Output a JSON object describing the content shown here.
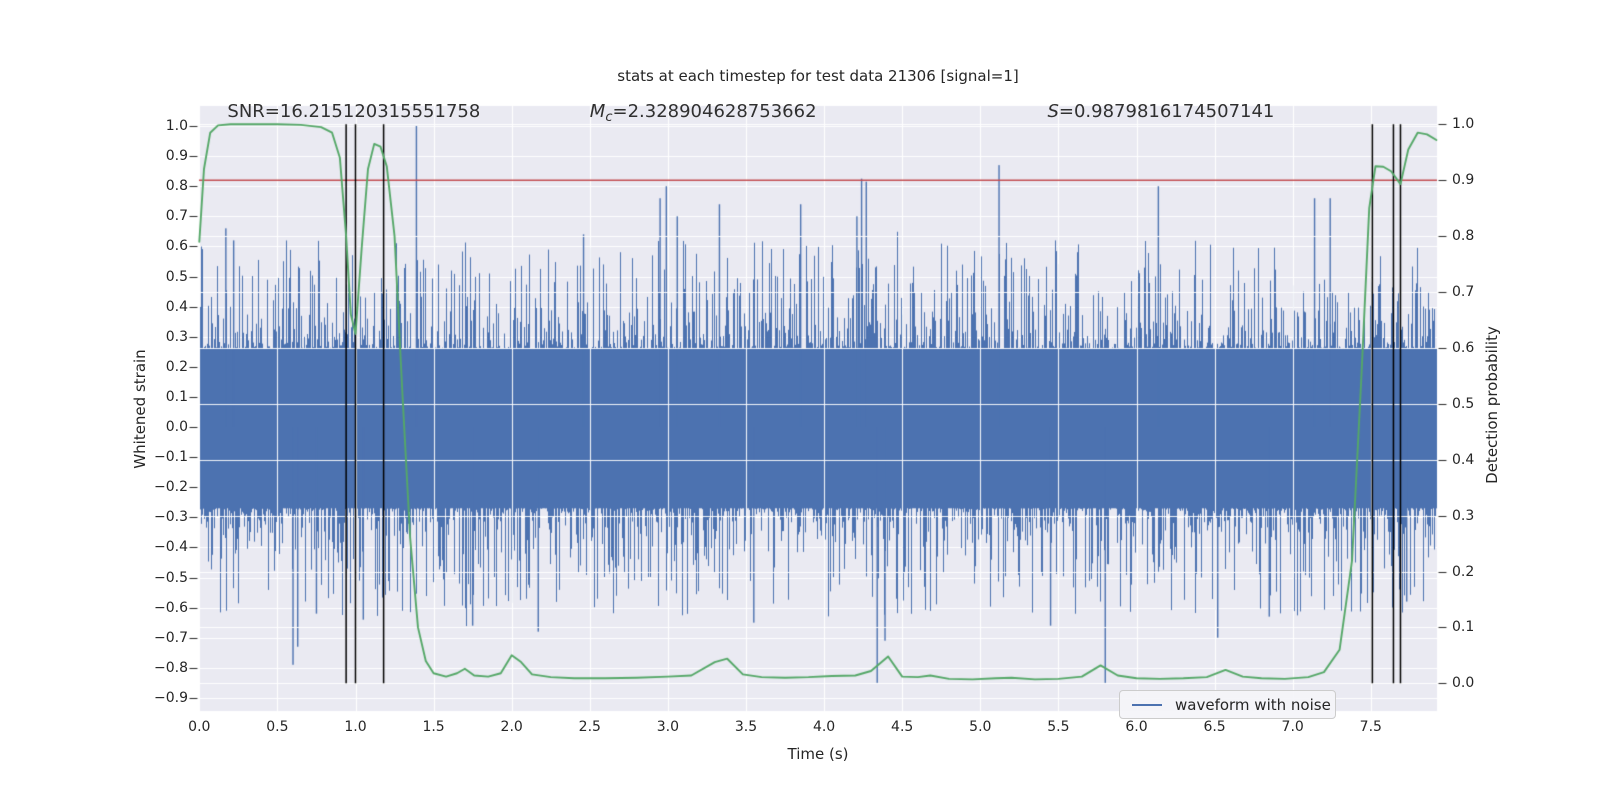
{
  "figure_title": "stats at each timestep for test data 21306 [signal=1]",
  "annotations": [
    {
      "name": "snr",
      "x": 0.18,
      "segments": [
        {
          "text": "SNR=16.215120315551758",
          "style": "plain"
        }
      ]
    },
    {
      "name": "chirp-mass",
      "x": 2.5,
      "segments": [
        {
          "text": "M",
          "style": "italic"
        },
        {
          "text": "c",
          "style": "sub"
        },
        {
          "text": "=2.328904628753662",
          "style": "plain"
        }
      ]
    },
    {
      "name": "s-stat",
      "x": 5.43,
      "segments": [
        {
          "text": "S",
          "style": "italic"
        },
        {
          "text": "=0.9879816174507141",
          "style": "plain"
        }
      ]
    }
  ],
  "legend": {
    "label": "waveform with noise"
  },
  "chart_data": {
    "type": "line",
    "title": "stats at each timestep for test data 21306 [signal=1]",
    "x_axis": {
      "label": "Time (s)",
      "range": [
        0,
        7.92
      ],
      "ticks": [
        0.0,
        0.5,
        1.0,
        1.5,
        2.0,
        2.5,
        3.0,
        3.5,
        4.0,
        4.5,
        5.0,
        5.5,
        6.0,
        6.5,
        7.0,
        7.5
      ]
    },
    "y_left": {
      "label": "Whitened strain",
      "range": [
        -0.943,
        1.067
      ],
      "ticks": [
        1.0,
        0.9,
        0.8,
        0.7,
        0.6,
        0.5,
        0.4,
        0.3,
        0.2,
        0.1,
        0.0,
        -0.1,
        -0.2,
        -0.3,
        -0.4,
        -0.5,
        -0.6,
        -0.7,
        -0.8,
        -0.9
      ]
    },
    "y_right": {
      "label": "Detection probability",
      "range": [
        -0.05,
        1.033
      ],
      "ticks": [
        1.0,
        0.9,
        0.8,
        0.7,
        0.6,
        0.5,
        0.4,
        0.3,
        0.2,
        0.1,
        0.0
      ]
    },
    "grid": {
      "on": true,
      "color": "#ffffff"
    },
    "threshold_line": {
      "axis": "right",
      "value": 0.9,
      "color": "#c44e52"
    },
    "event_vlines": {
      "color": "#000000",
      "prob_span": [
        0,
        1
      ],
      "times": [
        0.94,
        1.0,
        1.18,
        7.51,
        7.645,
        7.69
      ]
    },
    "series": [
      {
        "name": "waveform with noise",
        "kind": "noise_band",
        "axis": "left",
        "color": "#4c72b0",
        "seed": 21306,
        "core_band": [
          -0.27,
          0.26
        ],
        "tail_scale": 0.36,
        "tail_power": 4,
        "extreme_spikes": [
          [
            0.17,
            0.66
          ],
          [
            0.22,
            0.62
          ],
          [
            0.6,
            -0.79
          ],
          [
            0.63,
            -0.73
          ],
          [
            0.75,
            -0.62
          ],
          [
            1.05,
            -0.64
          ],
          [
            1.39,
            1.0
          ],
          [
            1.75,
            -0.66
          ],
          [
            2.17,
            -0.68
          ],
          [
            2.46,
            0.64
          ],
          [
            2.95,
            0.76
          ],
          [
            2.99,
            0.8
          ],
          [
            3.06,
            0.7
          ],
          [
            3.33,
            0.74
          ],
          [
            3.55,
            -0.65
          ],
          [
            3.85,
            0.74
          ],
          [
            4.21,
            0.7
          ],
          [
            4.24,
            0.825
          ],
          [
            4.27,
            0.815
          ],
          [
            4.34,
            -0.85
          ],
          [
            4.39,
            -0.71
          ],
          [
            5.12,
            0.87
          ],
          [
            5.45,
            -0.66
          ],
          [
            5.8,
            -0.85
          ],
          [
            6.14,
            0.8
          ],
          [
            6.52,
            -0.7
          ],
          [
            6.85,
            -0.63
          ],
          [
            7.14,
            0.76
          ],
          [
            7.24,
            0.76
          ],
          [
            7.73,
            -0.58
          ]
        ]
      },
      {
        "name": "detection probability",
        "kind": "line",
        "axis": "right",
        "color": "#55a868",
        "points": [
          [
            0.0,
            0.79
          ],
          [
            0.03,
            0.92
          ],
          [
            0.07,
            0.985
          ],
          [
            0.12,
            0.998
          ],
          [
            0.2,
            1.0
          ],
          [
            0.35,
            1.0
          ],
          [
            0.5,
            1.0
          ],
          [
            0.65,
            0.999
          ],
          [
            0.78,
            0.995
          ],
          [
            0.85,
            0.985
          ],
          [
            0.9,
            0.94
          ],
          [
            0.94,
            0.8
          ],
          [
            0.97,
            0.66
          ],
          [
            1.0,
            0.625
          ],
          [
            1.04,
            0.78
          ],
          [
            1.08,
            0.92
          ],
          [
            1.12,
            0.965
          ],
          [
            1.16,
            0.96
          ],
          [
            1.2,
            0.925
          ],
          [
            1.25,
            0.8
          ],
          [
            1.3,
            0.52
          ],
          [
            1.35,
            0.26
          ],
          [
            1.4,
            0.1
          ],
          [
            1.45,
            0.04
          ],
          [
            1.5,
            0.018
          ],
          [
            1.58,
            0.012
          ],
          [
            1.65,
            0.018
          ],
          [
            1.7,
            0.026
          ],
          [
            1.76,
            0.014
          ],
          [
            1.85,
            0.012
          ],
          [
            1.93,
            0.018
          ],
          [
            2.0,
            0.05
          ],
          [
            2.06,
            0.038
          ],
          [
            2.13,
            0.016
          ],
          [
            2.25,
            0.011
          ],
          [
            2.4,
            0.009
          ],
          [
            2.6,
            0.009
          ],
          [
            2.8,
            0.01
          ],
          [
            3.0,
            0.012
          ],
          [
            3.15,
            0.014
          ],
          [
            3.3,
            0.038
          ],
          [
            3.38,
            0.044
          ],
          [
            3.48,
            0.016
          ],
          [
            3.6,
            0.011
          ],
          [
            3.75,
            0.01
          ],
          [
            3.9,
            0.011
          ],
          [
            4.05,
            0.013
          ],
          [
            4.2,
            0.014
          ],
          [
            4.3,
            0.022
          ],
          [
            4.41,
            0.048
          ],
          [
            4.5,
            0.012
          ],
          [
            4.6,
            0.011
          ],
          [
            4.68,
            0.014
          ],
          [
            4.8,
            0.008
          ],
          [
            4.95,
            0.007
          ],
          [
            5.1,
            0.009
          ],
          [
            5.2,
            0.01
          ],
          [
            5.35,
            0.007
          ],
          [
            5.5,
            0.008
          ],
          [
            5.65,
            0.012
          ],
          [
            5.77,
            0.032
          ],
          [
            5.88,
            0.014
          ],
          [
            6.0,
            0.009
          ],
          [
            6.15,
            0.008
          ],
          [
            6.3,
            0.009
          ],
          [
            6.45,
            0.011
          ],
          [
            6.57,
            0.024
          ],
          [
            6.68,
            0.012
          ],
          [
            6.8,
            0.009
          ],
          [
            6.95,
            0.008
          ],
          [
            7.1,
            0.011
          ],
          [
            7.2,
            0.02
          ],
          [
            7.3,
            0.06
          ],
          [
            7.38,
            0.22
          ],
          [
            7.44,
            0.55
          ],
          [
            7.49,
            0.85
          ],
          [
            7.53,
            0.925
          ],
          [
            7.58,
            0.924
          ],
          [
            7.63,
            0.916
          ],
          [
            7.69,
            0.893
          ],
          [
            7.74,
            0.955
          ],
          [
            7.8,
            0.985
          ],
          [
            7.86,
            0.982
          ],
          [
            7.92,
            0.972
          ]
        ]
      }
    ],
    "colors": {
      "axes_background": "#eaeaf2",
      "grid": "#ffffff",
      "waveform": "#4c72b0",
      "probability": "#55a868",
      "threshold": "#c44e52",
      "vline": "#000000",
      "text": "#262626"
    }
  }
}
